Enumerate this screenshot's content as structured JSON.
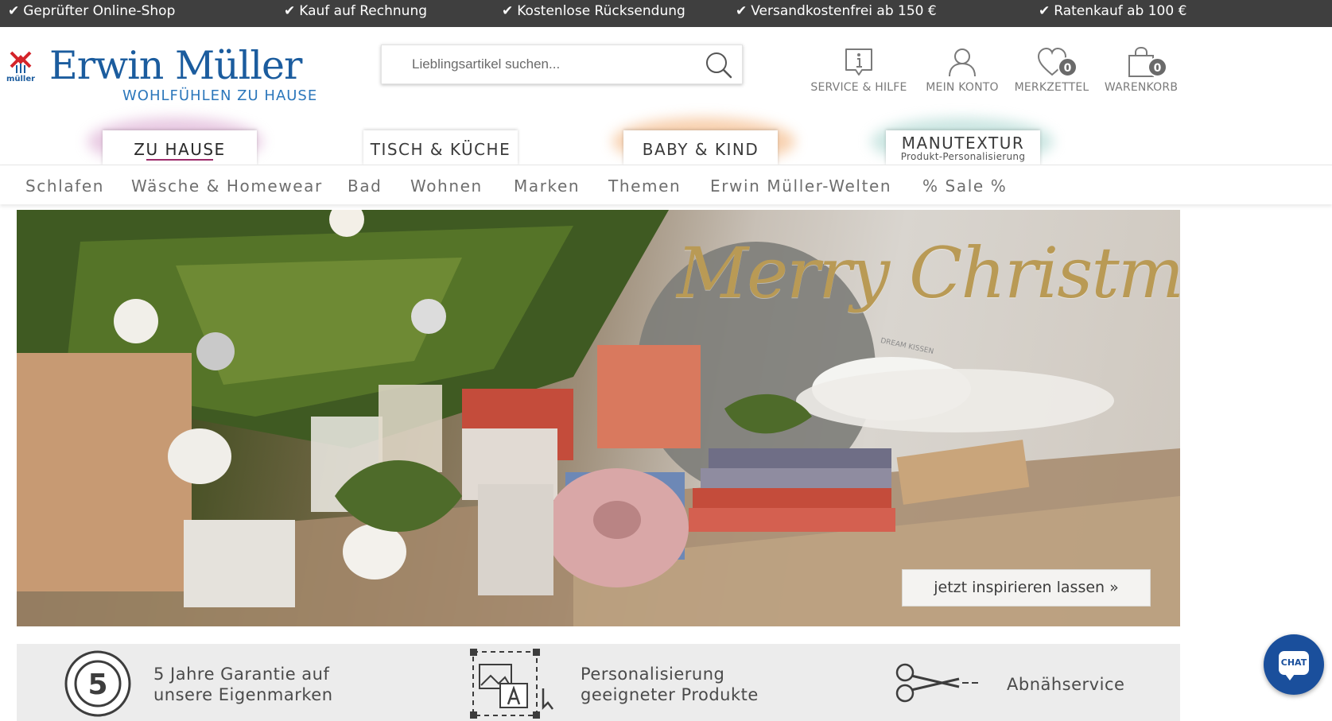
{
  "usp_bar": {
    "items": [
      "Geprüfter Online-Shop",
      "Kauf auf Rechnung",
      "Kostenlose Rücksendung",
      "Versandkostenfrei ab 150 €",
      "Ratenkauf ab 100 €"
    ],
    "icon": "check-icon"
  },
  "header": {
    "logo_mark": "müller",
    "brand": "Erwin Müller",
    "tagline": "WOHLFÜHLEN ZU HAUSE",
    "search": {
      "placeholder": "Lieblingsartikel suchen...",
      "icon": "search-icon"
    },
    "icons": {
      "service": {
        "label": "SERVICE & HILFE",
        "icon": "info-icon"
      },
      "account": {
        "label": "MEIN KONTO",
        "icon": "user-icon"
      },
      "wishlist": {
        "label": "MERKZETTEL",
        "icon": "heart-icon",
        "count": "0"
      },
      "cart": {
        "label": "WARENKORB",
        "icon": "shopping-bag-icon",
        "count": "0"
      }
    }
  },
  "category_tabs": [
    {
      "label": "ZU HAUSE",
      "active": true
    },
    {
      "label": "TISCH & KÜCHE",
      "active": false
    },
    {
      "label": "BABY & KIND",
      "active": false
    },
    {
      "label": "MANUTEXTUR",
      "sublabel": "Produkt-Personalisierung",
      "active": false
    }
  ],
  "subnav": [
    "Schlafen",
    "Wäsche & Homewear",
    "Bad",
    "Wohnen",
    "Marken",
    "Themen",
    "Erwin Müller-Welten",
    "% Sale %"
  ],
  "hero": {
    "title": "Merry Christmas",
    "pillow_text": "DREAM KISSEN",
    "cta": "jetzt inspirieren lassen »"
  },
  "benefits": [
    {
      "icon": "guarantee-seal-icon",
      "seal_number": "5",
      "line1": "5 Jahre Garantie auf",
      "line2": "unsere Eigenmarken"
    },
    {
      "icon": "personalization-icon",
      "line1": "Personalisierung",
      "line2": "geeigneter Produkte"
    },
    {
      "icon": "scissors-icon",
      "line1": "Abnähservice",
      "line2": ""
    }
  ],
  "chat": {
    "label": "CHAT",
    "icon": "chat-icon"
  },
  "colors": {
    "top_bar": "#3f3f3f",
    "brand_blue": "#1b5c9e",
    "accent_magenta": "#9c2b6a",
    "chat_blue": "#1a4f9c",
    "benefits_bg": "#ececec"
  }
}
